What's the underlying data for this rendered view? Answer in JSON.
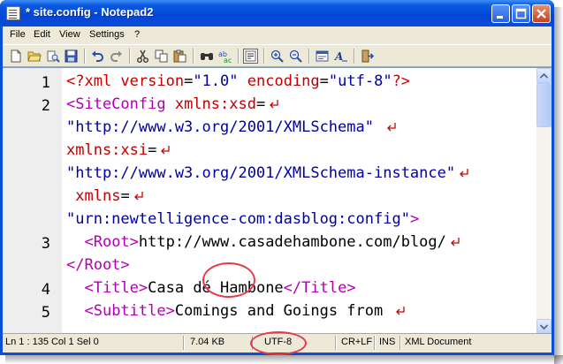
{
  "window": {
    "title": "* site.config - Notepad2"
  },
  "menu": [
    "File",
    "Edit",
    "View",
    "Settings",
    "?"
  ],
  "toolbar": {
    "icons": [
      "new-file-icon",
      "open-folder-icon",
      "browse-icon",
      "save-icon",
      "undo-icon",
      "redo-icon",
      "cut-icon",
      "copy-icon",
      "paste-icon",
      "find-icon",
      "replace-icon",
      "word-wrap-icon",
      "zoom-in-icon",
      "zoom-out-icon",
      "scheme-icon",
      "font-icon",
      "exit-icon"
    ]
  },
  "editor": {
    "line_numbers": [
      "1",
      "2",
      "3",
      "4",
      "5"
    ],
    "lines": [
      {
        "segments": [
          [
            "pi",
            "<?xml "
          ],
          [
            "attr",
            "version"
          ],
          [
            "plain",
            "="
          ],
          [
            "val",
            "\"1.0\""
          ],
          [
            "plain",
            " "
          ],
          [
            "attr",
            "encoding"
          ],
          [
            "plain",
            "="
          ],
          [
            "val",
            "\"utf-8\""
          ],
          [
            "pi",
            "?>"
          ]
        ],
        "wrap": false
      },
      {
        "segments": [
          [
            "tag",
            "<SiteConfig "
          ],
          [
            "attr",
            "xmlns:xsd"
          ],
          [
            "plain",
            "="
          ]
        ],
        "wrap": true
      },
      {
        "segments": [
          [
            "val",
            "\"http://www.w3.org/2001/XMLSchema\""
          ],
          [
            "plain",
            " "
          ]
        ],
        "wrap": true
      },
      {
        "segments": [
          [
            "attr",
            "xmlns:xsi"
          ],
          [
            "plain",
            "="
          ]
        ],
        "wrap": true
      },
      {
        "segments": [
          [
            "val",
            "\"http://www.w3.org/2001/XMLSchema-instance\""
          ]
        ],
        "wrap": true
      },
      {
        "segments": [
          [
            "plain",
            " "
          ],
          [
            "attr",
            "xmlns"
          ],
          [
            "plain",
            "="
          ]
        ],
        "wrap": true
      },
      {
        "segments": [
          [
            "val",
            "\"urn:newtelligence-com:dasblog:config\""
          ],
          [
            "tag",
            ">"
          ]
        ],
        "wrap": false
      },
      {
        "segments": [
          [
            "plain",
            "  "
          ],
          [
            "tag",
            "<Root>"
          ],
          [
            "plain",
            "http://www.casadehambone.com/blog/"
          ]
        ],
        "wrap": true
      },
      {
        "segments": [
          [
            "tag",
            "</Root>"
          ]
        ],
        "wrap": false
      },
      {
        "segments": [
          [
            "plain",
            "  "
          ],
          [
            "tag",
            "<Title>"
          ],
          [
            "plain",
            "Casa dé Hambone"
          ],
          [
            "tag",
            "</Title>"
          ]
        ],
        "wrap": false
      },
      {
        "segments": [
          [
            "plain",
            "  "
          ],
          [
            "tag",
            "<Subtitle>"
          ],
          [
            "plain",
            "Comings and Goings from "
          ]
        ],
        "wrap": true
      }
    ]
  },
  "statusbar": {
    "position": "Ln 1 : 135  Col 1  Sel 0",
    "size": "7.04 KB",
    "encoding": "UTF-8",
    "line_endings": "CR+LF",
    "mode": "INS",
    "document_type": "XML Document"
  },
  "colors": {
    "tag": "#b000b0",
    "attribute": "#c00000",
    "value": "#0000a0",
    "highlight": "#e8394a"
  }
}
